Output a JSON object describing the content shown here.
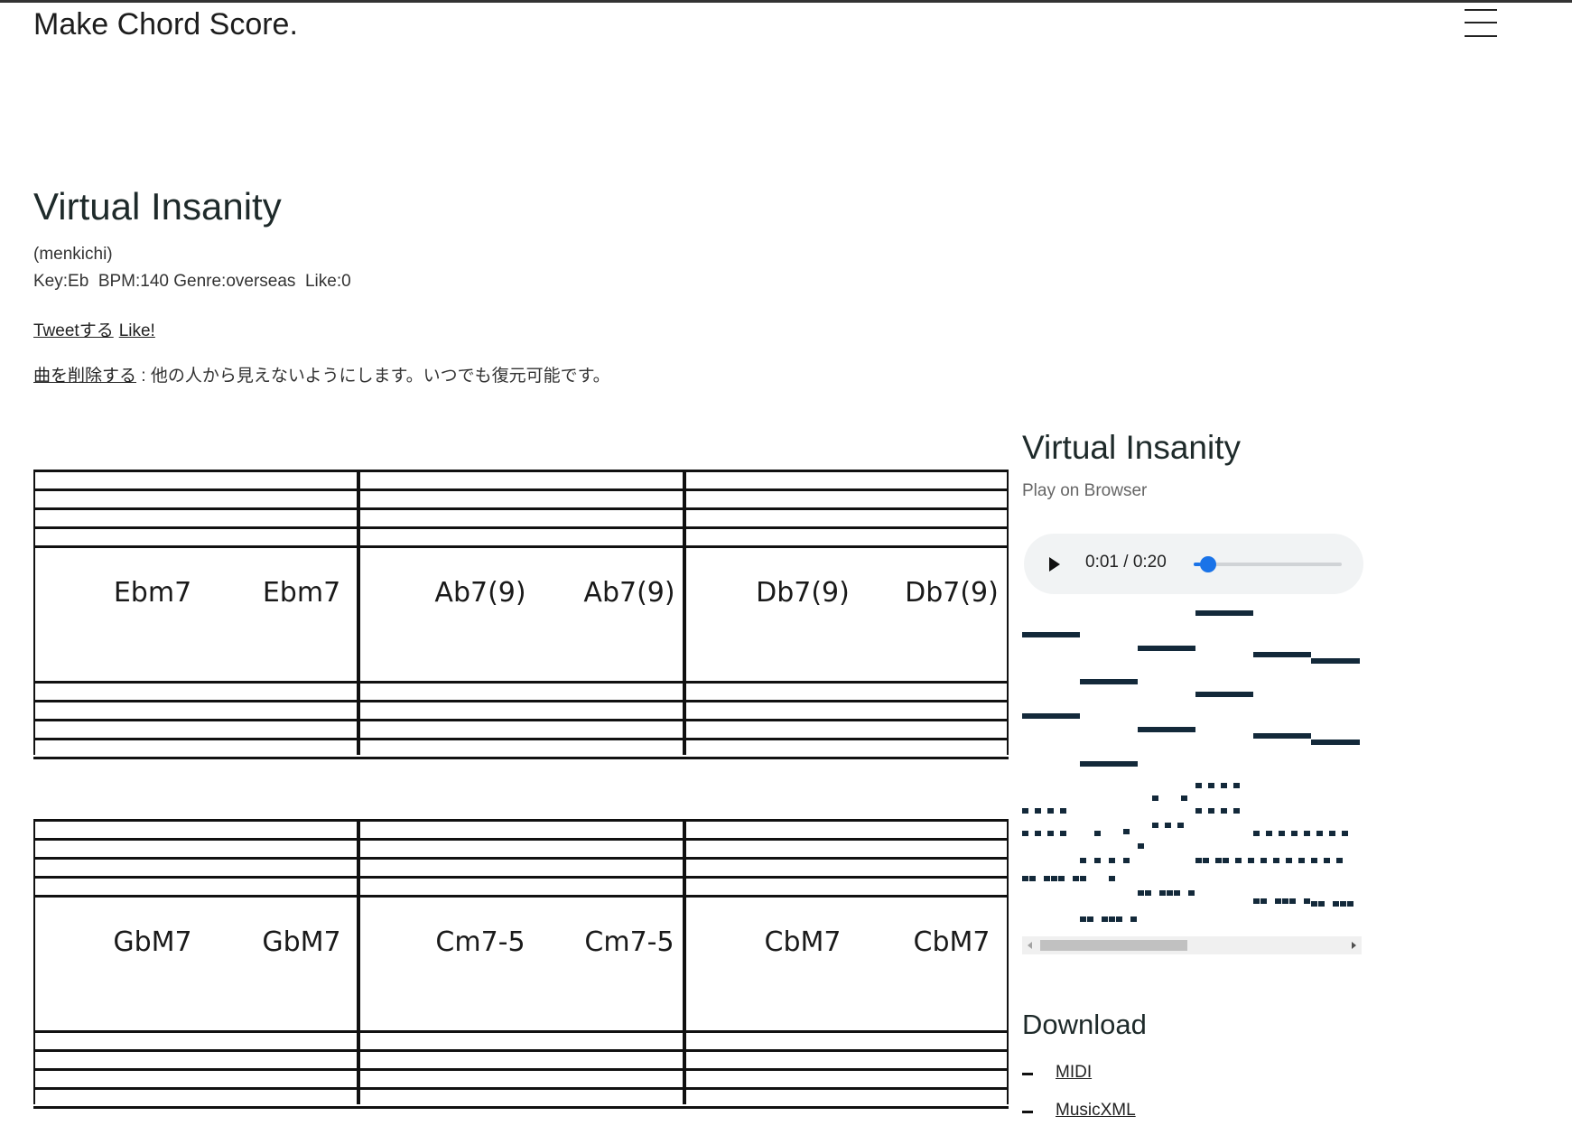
{
  "header": {
    "brand": "Make Chord Score.",
    "menu_icon": "hamburger-menu-icon"
  },
  "song": {
    "title": "Virtual Insanity",
    "author": "(menkichi)",
    "meta": "Key:Eb  BPM:140 Genre:overseas  Like:0",
    "tweet_label": "Tweetする",
    "like_label": "Like!",
    "delete_label": "曲を削除する",
    "delete_note": " : 他の人から見えないようにします。いつでも復元可能です。"
  },
  "score": {
    "rows": [
      {
        "chords": [
          "Ebm7",
          "Ebm7",
          "Ab7(9)",
          "Ab7(9)",
          "Db7(9)",
          "Db7(9)"
        ]
      },
      {
        "chords": [
          "GbM7",
          "GbM7",
          "Cm7-5",
          "Cm7-5",
          "CbM7",
          "CbM7"
        ]
      }
    ]
  },
  "player": {
    "title": "Virtual Insanity",
    "subtitle": "Play on Browser",
    "play_icon": "play-icon",
    "time": "0:01 / 0:20",
    "progress": 0.05
  },
  "download": {
    "title": "Download",
    "links": [
      "MIDI",
      "MusicXML"
    ]
  }
}
